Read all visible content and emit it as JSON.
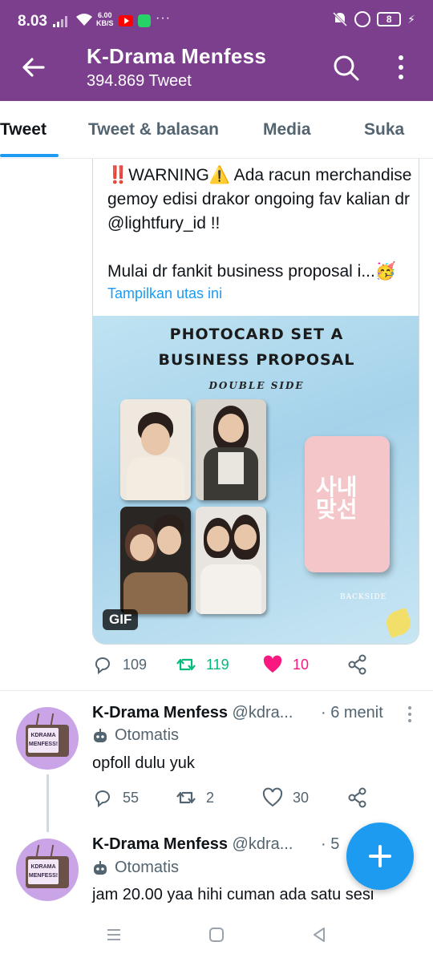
{
  "status_bar": {
    "time": "8.03",
    "net_speed_value": "6.00",
    "net_speed_unit": "KB/S",
    "more": "···",
    "battery": "8"
  },
  "header": {
    "title": "K-Drama Menfess",
    "subtitle": "394.869 Tweet"
  },
  "tabs": [
    {
      "label": "Tweet",
      "active": true
    },
    {
      "label": "Tweet & balasan",
      "active": false
    },
    {
      "label": "Media",
      "active": false
    },
    {
      "label": "Suka",
      "active": false
    }
  ],
  "quoted_tweet": {
    "text": "‼️WARNING⚠️ Ada racun merchandise gemoy edisi drakor ongoing fav kalian dr @lightfury_id !!\n\nMulai dr fankit business proposal i...🥳",
    "show_thread": "Tampilkan utas ini",
    "media": {
      "heading_line1": "PHOTOCARD SET A",
      "heading_line2": "BUSINESS PROPOSAL",
      "sub": "DOUBLE SIDE",
      "card_logo_line1": "사내",
      "card_logo_line2": "맞선",
      "card_backside": "BACKSIDE",
      "badge": "GIF"
    },
    "actions": {
      "replies": "109",
      "retweets": "119",
      "likes": "10"
    }
  },
  "tweets": [
    {
      "name": "K-Drama Menfess",
      "handle": "@kdra...",
      "time": "· 6 menit",
      "label": "Otomatis",
      "text": "opfoll dulu yuk",
      "avatar_text": "KDRAMA MENFESS!",
      "actions": {
        "replies": "55",
        "retweets": "2",
        "likes": "30"
      }
    },
    {
      "name": "K-Drama Menfess",
      "handle": "@kdra...",
      "time": "· 5",
      "label": "Otomatis",
      "text": "jam 20.00 yaa hihi cuman ada satu sesi",
      "avatar_text": "KDRAMA MENFESS!"
    }
  ],
  "colors": {
    "header_bg": "#7b3f8d",
    "accent": "#1d9bf0",
    "retweet": "#00ba7c",
    "like": "#f91880"
  }
}
